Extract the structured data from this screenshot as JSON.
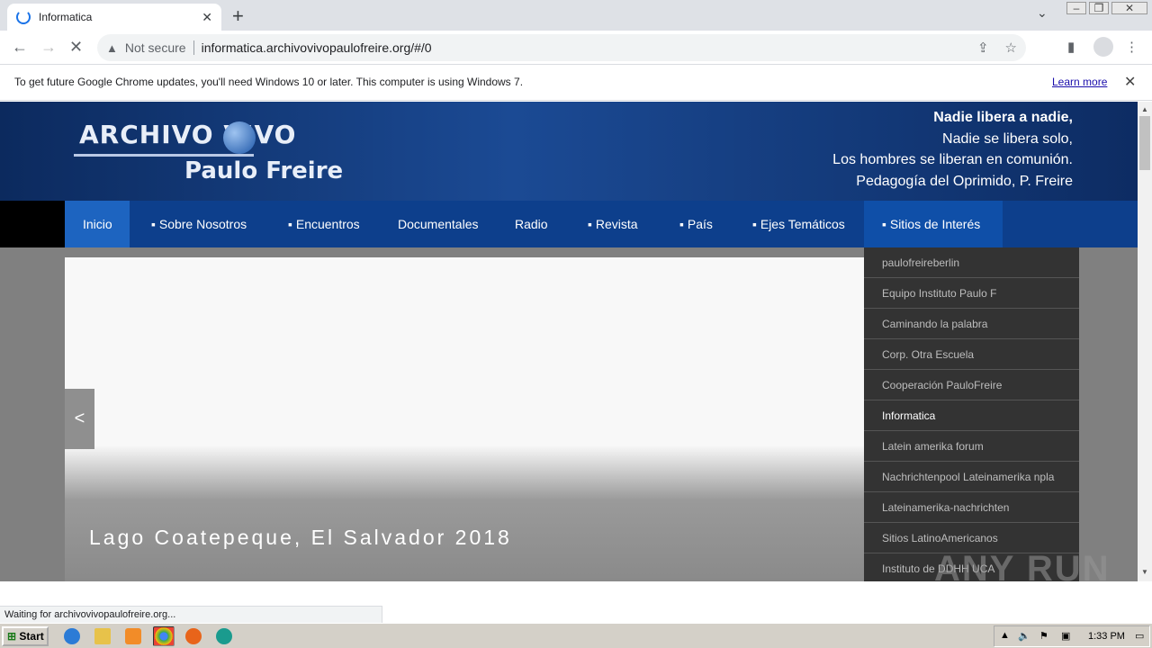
{
  "browser": {
    "tab_title": "Informatica",
    "tab_close": "✕",
    "new_tab": "+",
    "security_label": "Not secure",
    "url": "informatica.archivovivopaulofreire.org/#/0"
  },
  "infobar": {
    "message": "To get future Google Chrome updates, you'll need Windows 10 or later. This computer is using Windows 7.",
    "learn_more": "Learn more"
  },
  "site": {
    "logo_top": "ARCHIVO VIVO",
    "logo_bottom": "Paulo Freire",
    "quote": [
      "Nadie libera a nadie,",
      "Nadie se libera solo,",
      "Los hombres se liberan en comunión.",
      "Pedagogía del Oprimido,  P. Freire"
    ],
    "nav": [
      "Inicio",
      "▪ Sobre Nosotros",
      "▪ Encuentros",
      "Documentales",
      "Radio",
      "▪ Revista",
      "▪ País",
      "▪ Ejes Temáticos",
      "▪ Sitios de Interés"
    ],
    "dropdown": [
      "paulofreireberlin",
      "Equipo Instituto Paulo F",
      "Caminando la palabra",
      "Corp. Otra Escuela",
      "Cooperación PauloFreire",
      "Informatica",
      "Latein amerika forum",
      "Nachrichtenpool Lateinamerika npla",
      "Lateinamerika-nachrichten",
      "Sitios LatinoAmericanos",
      "Instituto de DDHH UCA"
    ],
    "slider_caption": "Lago Coatepeque, El Salvador 2018",
    "slider_prev": "<"
  },
  "status_bar": "Waiting for archivovivopaulofreire.org...",
  "watermark": "ANY RUN",
  "taskbar": {
    "start": "Start",
    "clock": "1:33 PM"
  }
}
